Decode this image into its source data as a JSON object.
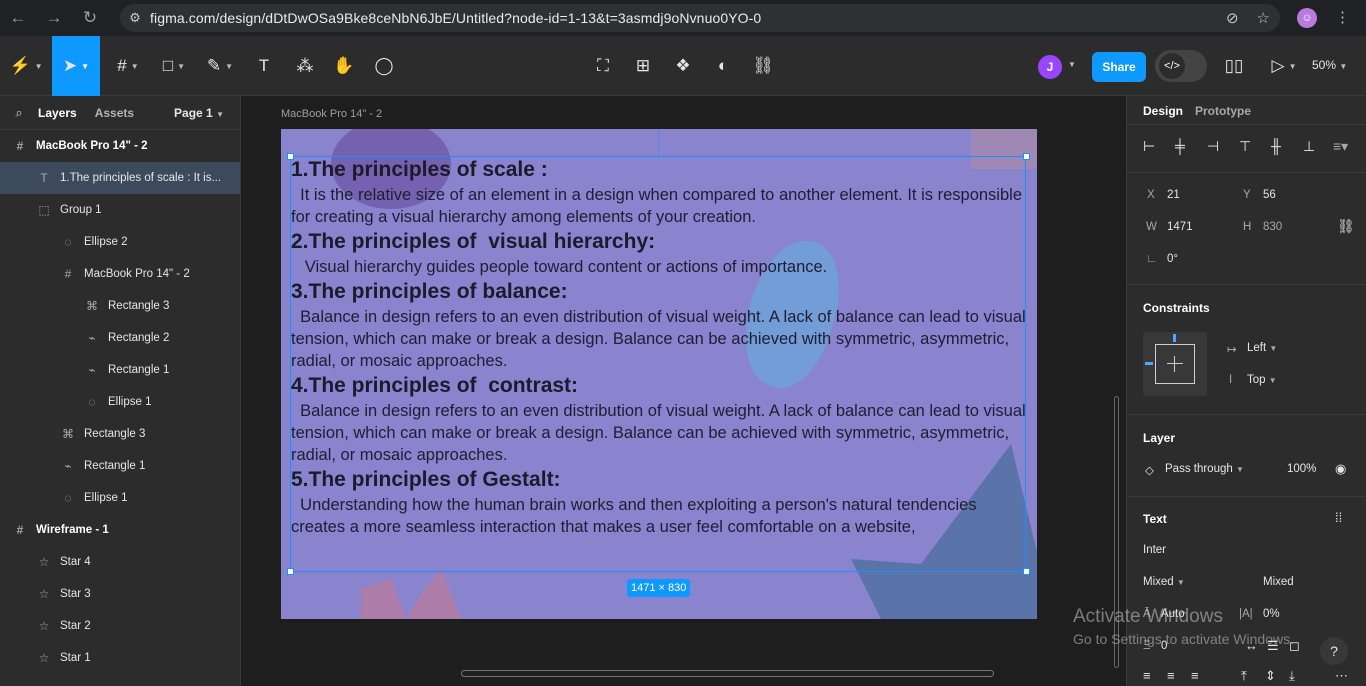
{
  "browser": {
    "url": "figma.com/design/dDtDwOSa9Bke8ceNbN6JbE/Untitled?node-id=1-13&t=3asmdj9oNvnuo0YO-0",
    "icons": [
      "back-icon",
      "forward-icon",
      "reload-icon",
      "site-info-icon",
      "no-tracking-icon",
      "bookmark-star-icon",
      "menu-dots-icon"
    ]
  },
  "toolbar": {
    "share_label": "Share",
    "zoom": "50%",
    "avatar_initial": "J",
    "tools": [
      "main-menu-icon",
      "move-tool-icon",
      "frame-tool-icon",
      "shape-tool-icon",
      "pen-tool-icon",
      "text-tool-icon",
      "actions-icon",
      "hand-tool-icon",
      "comment-tool-icon",
      "crop-icon",
      "grid-icon",
      "component-icon",
      "mask-icon",
      "link-icon",
      "library-icon",
      "present-icon"
    ]
  },
  "left_panel": {
    "tab_layers": "Layers",
    "tab_assets": "Assets",
    "page": "Page 1",
    "layers": [
      {
        "icon": "#",
        "label": "MacBook Pro 14\" - 2",
        "indent": 0,
        "frame": true,
        "selected": false
      },
      {
        "icon": "T",
        "label": "1.The principles of scale : It is...",
        "indent": 1,
        "frame": false,
        "selected": true
      },
      {
        "icon": "⬚",
        "label": "Group 1",
        "indent": 1,
        "frame": false,
        "selected": false
      },
      {
        "icon": "◌",
        "label": "Ellipse 2",
        "indent": 2,
        "frame": false,
        "selected": false
      },
      {
        "icon": "#",
        "label": "MacBook Pro 14\" - 2",
        "indent": 2,
        "frame": false,
        "selected": false
      },
      {
        "icon": "⌘",
        "label": "Rectangle 3",
        "indent": 3,
        "frame": false,
        "selected": false
      },
      {
        "icon": "⌁",
        "label": "Rectangle 2",
        "indent": 3,
        "frame": false,
        "selected": false
      },
      {
        "icon": "⌁",
        "label": "Rectangle 1",
        "indent": 3,
        "frame": false,
        "selected": false
      },
      {
        "icon": "◌",
        "label": "Ellipse 1",
        "indent": 3,
        "frame": false,
        "selected": false
      },
      {
        "icon": "⌘",
        "label": "Rectangle 3",
        "indent": 2,
        "frame": false,
        "selected": false
      },
      {
        "icon": "⌁",
        "label": "Rectangle 1",
        "indent": 2,
        "frame": false,
        "selected": false
      },
      {
        "icon": "◌",
        "label": "Ellipse 1",
        "indent": 2,
        "frame": false,
        "selected": false
      },
      {
        "icon": "#",
        "label": "Wireframe - 1",
        "indent": 0,
        "frame": true,
        "selected": false
      },
      {
        "icon": "☆",
        "label": "Star 4",
        "indent": 1,
        "frame": false,
        "selected": false
      },
      {
        "icon": "☆",
        "label": "Star 3",
        "indent": 1,
        "frame": false,
        "selected": false
      },
      {
        "icon": "☆",
        "label": "Star 2",
        "indent": 1,
        "frame": false,
        "selected": false
      },
      {
        "icon": "☆",
        "label": "Star 1",
        "indent": 1,
        "frame": false,
        "selected": false
      }
    ]
  },
  "canvas": {
    "frame_label": "MacBook Pro 14\" - 2",
    "size_badge": "1471 × 830",
    "blocks": [
      {
        "type": "h",
        "text": "1.The principles of scale :"
      },
      {
        "type": "p",
        "text": "  It is the relative size of an element in a design when compared to another element. It is responsible for creating a visual hierarchy among elements of your creation."
      },
      {
        "type": "h",
        "text": "2.The principles of  visual hierarchy:"
      },
      {
        "type": "p",
        "text": "   Visual hierarchy guides people toward content or actions of importance."
      },
      {
        "type": "h",
        "text": "3.The principles of balance:"
      },
      {
        "type": "p",
        "text": "  Balance in design refers to an even distribution of visual weight. A lack of balance can lead to visual tension, which can make or break a design. Balance can be achieved with symmetric, asymmetric, radial, or mosaic approaches."
      },
      {
        "type": "h",
        "text": "4.The principles of  contrast:"
      },
      {
        "type": "p",
        "text": "  Balance in design refers to an even distribution of visual weight. A lack of balance can lead to visual tension, which can make or break a design. Balance can be achieved with symmetric, asymmetric, radial, or mosaic approaches."
      },
      {
        "type": "h",
        "text": "5.The principles of Gestalt:"
      },
      {
        "type": "p",
        "text": "  Understanding how the human brain works and then exploiting a person's natural tendencies creates a more seamless interaction that makes a user feel comfortable on a website,"
      }
    ]
  },
  "right_panel": {
    "tab_design": "Design",
    "tab_prototype": "Prototype",
    "x_label": "X",
    "x_value": "21",
    "y_label": "Y",
    "y_value": "56",
    "w_label": "W",
    "w_value": "1471",
    "h_label": "H",
    "h_value": "830",
    "rotation": "0°",
    "constraints_title": "Constraints",
    "constraint_h": "Left",
    "constraint_v": "Top",
    "layer_title": "Layer",
    "blend_mode": "Pass through",
    "opacity": "100%",
    "text_title": "Text",
    "font_name": "Inter",
    "font_style": "Mixed",
    "font_size": "Mixed",
    "line_height": "Auto",
    "letter_spacing": "0%",
    "paragraph_spacing": "0"
  },
  "watermark": {
    "line1": "Activate Windows",
    "line2": "Go to Settings to activate Windows."
  },
  "help_label": "?"
}
